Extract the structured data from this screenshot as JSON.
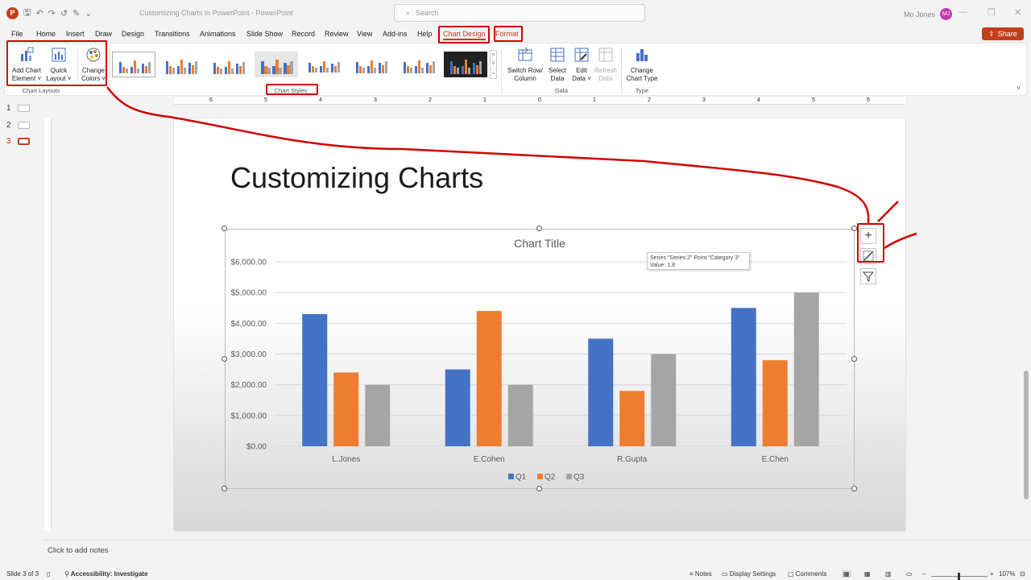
{
  "titlebar": {
    "doc_title": "Customizing Charts in PowerPoint  -  PowerPoint",
    "search_placeholder": "Search",
    "user_name": "Mo Jones",
    "user_initials": "MJ"
  },
  "tabs": [
    {
      "label": "File"
    },
    {
      "label": "Home"
    },
    {
      "label": "Insert"
    },
    {
      "label": "Draw"
    },
    {
      "label": "Design"
    },
    {
      "label": "Transitions"
    },
    {
      "label": "Animations"
    },
    {
      "label": "Slide Show"
    },
    {
      "label": "Record"
    },
    {
      "label": "Review"
    },
    {
      "label": "View"
    },
    {
      "label": "Add-ins"
    },
    {
      "label": "Help"
    },
    {
      "label": "Chart Design"
    },
    {
      "label": "Format"
    }
  ],
  "share_label": "Share",
  "ribbon": {
    "add_chart_element": [
      "Add Chart",
      "Element ˅"
    ],
    "quick_layout": [
      "Quick",
      "Layout ˅"
    ],
    "change_colors": [
      "Change",
      "Colors ˅"
    ],
    "chart_layouts_label": "Chart Layouts",
    "chart_styles_label": "Chart Styles",
    "switch_row_column": [
      "Switch Row/",
      "Column"
    ],
    "select_data": [
      "Select",
      "Data"
    ],
    "edit_data": [
      "Edit",
      "Data ˅"
    ],
    "refresh_data": [
      "Refresh",
      "Data"
    ],
    "data_label": "Data",
    "change_chart_type": [
      "Change",
      "Chart Type"
    ],
    "type_label": "Type"
  },
  "ruler_labels": [
    "6",
    "5",
    "4",
    "3",
    "2",
    "1",
    "0",
    "1",
    "2",
    "3",
    "4",
    "5",
    "6"
  ],
  "slides": [
    {
      "num": "1"
    },
    {
      "num": "2"
    },
    {
      "num": "3"
    }
  ],
  "slide": {
    "title": "Customizing Charts"
  },
  "tooltip": {
    "line1": "Series \"Series 2\" Point \"Category 3\"",
    "line2": "Value: 1.8"
  },
  "chart_data": {
    "type": "bar",
    "title": "Chart Title",
    "categories": [
      "L.Jones",
      "E.Cohen",
      "R.Gupta",
      "E.Chen"
    ],
    "series": [
      {
        "name": "Q1",
        "values": [
          4300,
          2500,
          3500,
          4500
        ],
        "color": "#4472c4"
      },
      {
        "name": "Q2",
        "values": [
          2400,
          4400,
          1800,
          2800
        ],
        "color": "#ed7d31"
      },
      {
        "name": "Q3",
        "values": [
          2000,
          2000,
          3000,
          5000
        ],
        "color": "#a5a5a5"
      }
    ],
    "y_ticks": [
      "$0.00",
      "$1,000.00",
      "$2,000.00",
      "$3,000.00",
      "$4,000.00",
      "$5,000.00",
      "$6,000.00"
    ],
    "ylim": [
      0,
      6000
    ],
    "grid": true,
    "legend": "bottom"
  },
  "notes_placeholder": "Click to add notes",
  "status": {
    "slide_of": "Slide 3 of 3",
    "accessibility": "Accessibility: Investigate",
    "notes": "Notes",
    "display_settings": "Display Settings",
    "comments": "Comments",
    "zoom": "107%"
  },
  "colors": {
    "accent": "#c43e1c",
    "annotation": "#d10000"
  }
}
